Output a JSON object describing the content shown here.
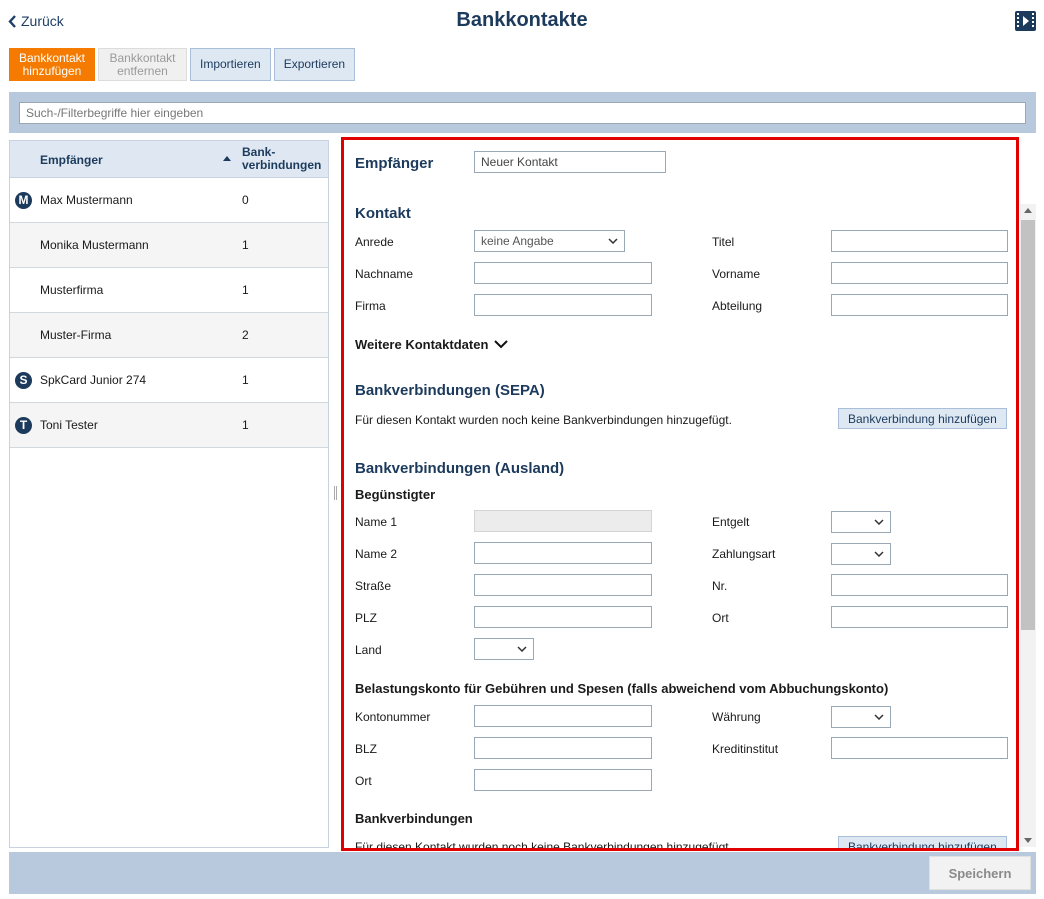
{
  "header": {
    "back_label": "Zurück",
    "title": "Bankkontakte",
    "video_icon": "video-help-icon"
  },
  "toolbar": {
    "add_label_1": "Bankkontakt",
    "add_label_2": "hinzufügen",
    "remove_label_1": "Bankkontakt",
    "remove_label_2": "entfernen",
    "import_label": "Importieren",
    "export_label": "Exportieren"
  },
  "filter": {
    "placeholder": "Such-/Filterbegriffe hier eingeben"
  },
  "list": {
    "col_recipient": "Empfänger",
    "col_bank_1": "Bank-",
    "col_bank_2": "verbindungen",
    "rows": [
      {
        "badge": "M",
        "name": "Max Mustermann",
        "count": "0"
      },
      {
        "badge": "",
        "name": "Monika Mustermann",
        "count": "1"
      },
      {
        "badge": "",
        "name": "Musterfirma",
        "count": "1"
      },
      {
        "badge": "",
        "name": "Muster-Firma",
        "count": "2"
      },
      {
        "badge": "S",
        "name": "SpkCard Junior 274",
        "count": "1"
      },
      {
        "badge": "T",
        "name": "Toni Tester",
        "count": "1"
      }
    ]
  },
  "form": {
    "recipient_label": "Empfänger",
    "recipient_value": "Neuer Kontakt",
    "contact_heading": "Kontakt",
    "salutation_label": "Anrede",
    "salutation_value": "keine Angabe",
    "title_label": "Titel",
    "lastname_label": "Nachname",
    "firstname_label": "Vorname",
    "company_label": "Firma",
    "department_label": "Abteilung",
    "more_contact": "Weitere Kontaktdaten",
    "sepa_heading": "Bankverbindungen (SEPA)",
    "sepa_empty": "Für diesen Kontakt wurden noch keine Bankverbindungen hinzugefügt.",
    "add_bank_button": "Bankverbindung hinzufügen",
    "foreign_heading": "Bankverbindungen (Ausland)",
    "beneficiary_heading": "Begünstigter",
    "name1_label": "Name 1",
    "fee_label": "Entgelt",
    "name2_label": "Name 2",
    "paytype_label": "Zahlungsart",
    "street_label": "Straße",
    "number_label": "Nr.",
    "zip_label": "PLZ",
    "city_label": "Ort",
    "country_label": "Land",
    "charge_heading": "Belastungskonto für Gebühren und Spesen (falls abweichend vom Abbuchungskonto)",
    "account_label": "Kontonummer",
    "currency_label": "Währung",
    "blz_label": "BLZ",
    "bank_institute_label": "Kreditinstitut",
    "charge_city_label": "Ort",
    "bank_heading": "Bankverbindungen",
    "bank_empty": "Für diesen Kontakt wurden noch keine Bankverbindungen hinzugefügt.",
    "add_bank_button_2": "Bankverbindung hinzufügen"
  },
  "footer": {
    "save_label": "Speichern"
  },
  "colors": {
    "accent": "#f57b00",
    "primary_text": "#1c3a5c",
    "highlight_border": "#e00000",
    "bar_background": "#b8c9dd"
  }
}
